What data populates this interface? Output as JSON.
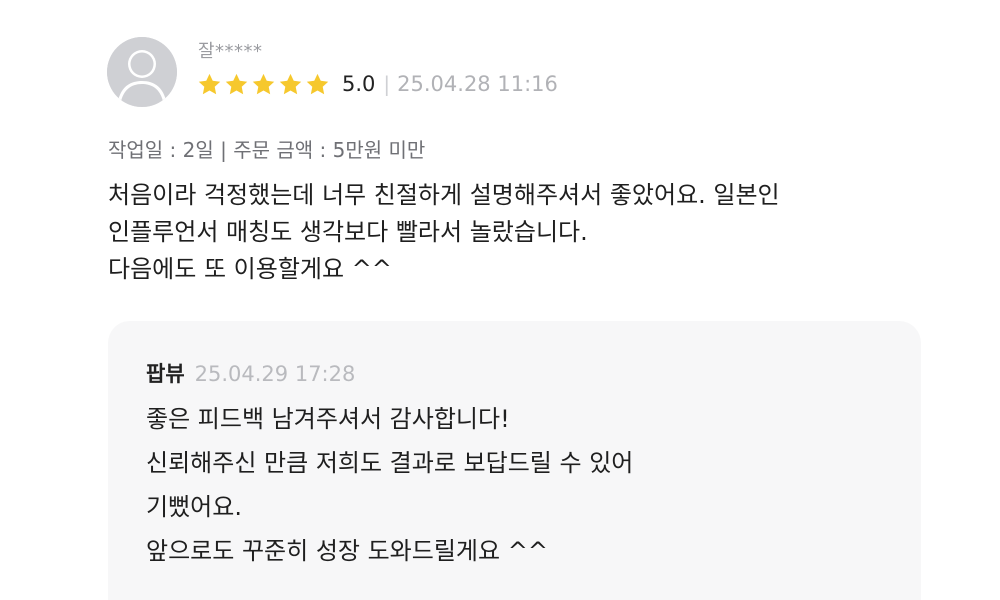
{
  "review": {
    "reviewer_name": "잘*****",
    "rating": 5,
    "rating_text": "5.0",
    "separator": "|",
    "date": "25.04.28 11:16",
    "meta": "작업일 : 2일 | 주문 금액 : 5만원 미만",
    "body": [
      "처음이라 걱정했는데 너무 친절하게 설명해주셔서 좋았어요. 일본인",
      "인플루언서 매칭도 생각보다 빨라서 놀랐습니다.",
      "다음에도 또 이용할게요 ^^"
    ],
    "star_color": "#f6c82d",
    "avatar_icon": "default-user-icon"
  },
  "reply": {
    "author": "팝뷰",
    "date": "25.04.29 17:28",
    "body": [
      "좋은 피드백 남겨주셔서 감사합니다!",
      "신뢰해주신 만큼 저희도 결과로 보답드릴 수 있어",
      "기뻤어요.",
      "앞으로도 꾸준히 성장 도와드릴게요 ^^"
    ]
  }
}
